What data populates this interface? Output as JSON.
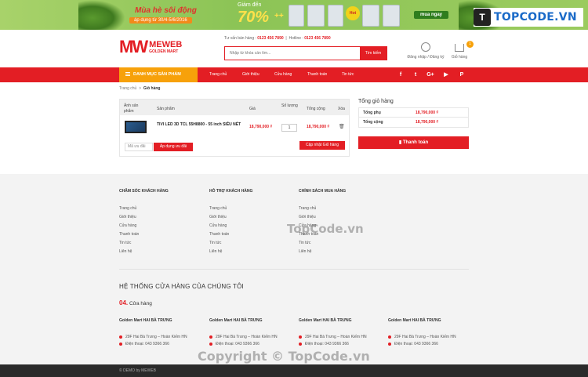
{
  "promo": {
    "headline": "Mùa hè sôi động",
    "dates": "áp dụng từ 30/4-5/6/2016",
    "upto": "Giảm đến",
    "percent": "70%",
    "plus": "++",
    "badge": "Hot",
    "cta": "mua ngay"
  },
  "watermark_logo": {
    "mark": "T",
    "text": "TOPCODE.VN"
  },
  "header": {
    "logo_mark": "MW",
    "logo_brand": "MEWEB",
    "logo_tagline": "GOLDEN MART",
    "hotline_label": "Tư vấn bán hàng :",
    "hotline_number": "0123 456 7890",
    "hotline2_label": "Hotline :",
    "hotline2_number": "0123 456 7890",
    "search_placeholder": "Nhập từ khóa cần tìm...",
    "search_button": "Tìm kiếm",
    "account_label": "Đăng nhập / Đăng ký",
    "cart_label": "Giỏ hàng",
    "cart_count": "1"
  },
  "nav": {
    "category_label": "DANH MỤC SẢN PHẨM",
    "items": [
      "Trang chủ",
      "Giới thiệu",
      "Cửa hàng",
      "Thanh toán",
      "Tin tức"
    ],
    "social": [
      "f",
      "t",
      "G+",
      "▶",
      "P"
    ]
  },
  "breadcrumb": {
    "home": "Trang chủ",
    "sep": ">",
    "current": "Giỏ hàng"
  },
  "cart": {
    "headers": {
      "image": "Ảnh sản phẩm",
      "product": "Sản phẩm",
      "price": "Giá",
      "qty": "Số lượng",
      "total": "Tổng cộng",
      "delete": "Xóa"
    },
    "rows": [
      {
        "name": "TIVI LED 3D TCL 55H8800 - 55 inch SIÊU NÉT",
        "price": "18,790,000 ₫",
        "qty": "1",
        "total": "18,790,000 ₫"
      }
    ],
    "coupon_placeholder": "Mã ưu đãi",
    "apply_button": "Áp dụng ưu đãi",
    "update_button": "Cập nhật Giỏ hàng"
  },
  "totals": {
    "title": "Tổng giỏ hàng",
    "subtotal_label": "Tổng phụ",
    "subtotal_value": "18,790,000 ₫",
    "total_label": "Tổng cộng",
    "total_value": "18,790,000 ₫",
    "pay_button": "Thanh toán"
  },
  "footer": {
    "cols": [
      {
        "heading": "CHĂM SÓC KHÁCH HÀNG",
        "items": [
          "Trang chủ",
          "Giới thiệu",
          "Cửa hàng",
          "Thanh toán",
          "Tin tức",
          "Liên hệ"
        ]
      },
      {
        "heading": "HỖ TRỢ KHÁCH HÀNG",
        "items": [
          "Trang chủ",
          "Giới thiệu",
          "Cửa hàng",
          "Thanh toán",
          "Tin tức",
          "Liên hệ"
        ]
      },
      {
        "heading": "CHÍNH SÁCH MUA HÀNG",
        "items": [
          "Trang chủ",
          "Giới thiệu",
          "Cửa hàng",
          "Thanh toán",
          "Tin tức",
          "Liên hệ"
        ]
      }
    ],
    "system_title": "HỆ THỐNG CỬA HÀNG CỦA CHÚNG TÔI",
    "store_count": "04.",
    "store_label": "Cửa hàng",
    "stores": [
      {
        "name": "Golden Mart HAI BÀ TRƯNG",
        "address": "29F Hai Bà Trưng – Hoàn Kiếm HN",
        "phone": "Điện thoại: 043 9366 366"
      },
      {
        "name": "Golden Mart HAI BÀ TRƯNG",
        "address": "29F Hai Bà Trưng – Hoàn Kiếm HN",
        "phone": "Điện thoại: 043 9366 366"
      },
      {
        "name": "Golden Mart HAI BÀ TRƯNG",
        "address": "29F Hai Bà Trưng – Hoàn Kiếm HN",
        "phone": "Điện thoại: 043 9366 366"
      },
      {
        "name": "Golden Mart HAI BÀ TRƯNG",
        "address": "29F Hai Bà Trưng – Hoàn Kiếm HN",
        "phone": "Điện thoại: 043 9366 366"
      }
    ],
    "copyright": "© DEMO by MEWEB"
  },
  "watermarks": {
    "center": "TopCode.vn",
    "bottom": "Copyright © TopCode.vn"
  }
}
